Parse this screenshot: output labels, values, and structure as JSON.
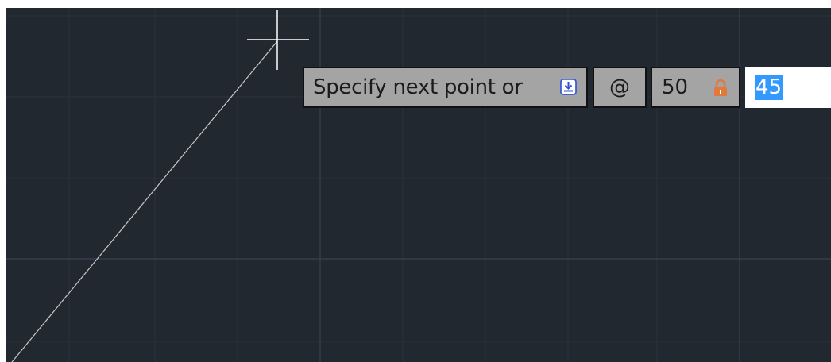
{
  "dynamic_input": {
    "prompt": "Specify next point or",
    "prompt_options_icon": "dropdown-arrow-icon",
    "relative_prefix": "@",
    "length_value": "50",
    "length_lock_icon": "lock-icon",
    "angle_value": "45"
  },
  "colors": {
    "viewport_background": "#212830",
    "grid_line": "#323c48",
    "prompt_field_background": "#a4a4a4",
    "selection_highlight": "#3399ff",
    "lock_icon": "#e07a3c",
    "dropdown_icon": "#2c4fd8",
    "rubber_band_line": "#c8c8c8",
    "crosshair": "#ffffff"
  }
}
